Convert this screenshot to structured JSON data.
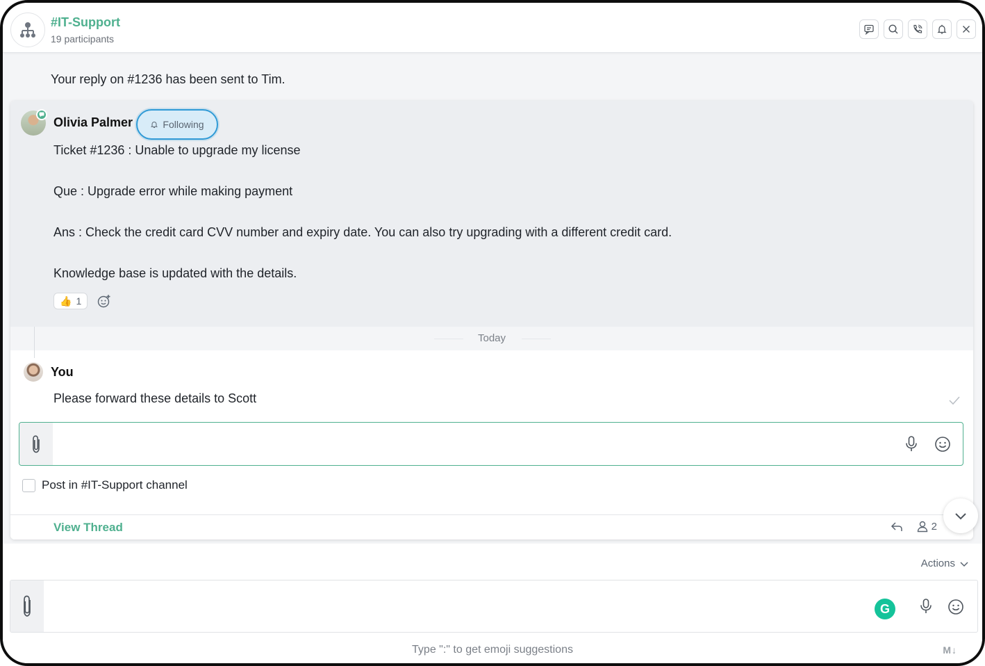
{
  "header": {
    "title": "#IT-Support",
    "subtitle": "19 participants",
    "icons": [
      "discussion-icon",
      "search-icon",
      "call-icon",
      "bell-icon",
      "close-icon"
    ]
  },
  "notice": "Your reply on #1236 has been sent to Tim.",
  "parent_message": {
    "sender": "Olivia Palmer",
    "follow_label": "Following",
    "lines": [
      "Ticket #1236 : Unable to upgrade my license",
      "Que : Upgrade error while making payment",
      "Ans : Check the credit card CVV number and expiry date. You can also try upgrading with a different credit card.",
      "Knowledge base is updated with the details."
    ],
    "reaction": {
      "emoji": "👍",
      "count": "1"
    }
  },
  "divider": {
    "label": "Today"
  },
  "reply": {
    "sender": "You",
    "text": "Please forward these details to Scott"
  },
  "reply_composer": {
    "value": "",
    "placeholder": ""
  },
  "post_in_channel": {
    "label": "Post in #IT-Support channel",
    "checked": false
  },
  "thread_footer": {
    "view_thread": "View Thread",
    "participant_count": "2"
  },
  "bottom": {
    "actions_label": "Actions",
    "composer_value": "",
    "grammarly_letter": "G",
    "hint": "Type \":\" to get emoji suggestions",
    "markdown_label": "M↓"
  },
  "colors": {
    "accent": "#4fb08f",
    "follow_border": "#2f9ad6",
    "grammarly": "#15c39a"
  }
}
